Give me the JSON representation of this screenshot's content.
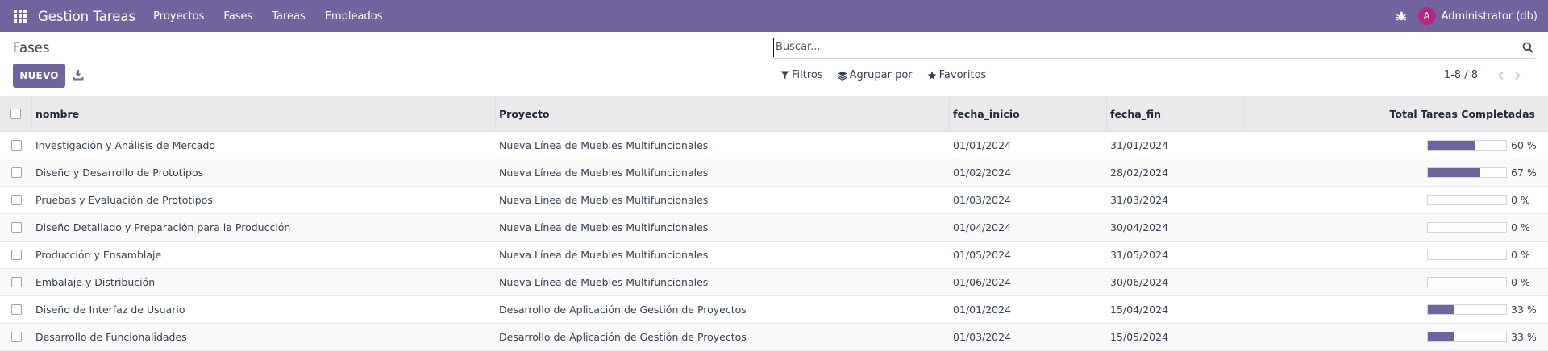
{
  "navbar": {
    "brand": "Gestion Tareas",
    "menu": [
      "Proyectos",
      "Fases",
      "Tareas",
      "Empleados"
    ],
    "avatar_letter": "A",
    "user": "Administrator (db)"
  },
  "control": {
    "title": "Fases",
    "new_label": "NUEVO",
    "search_placeholder": "Buscar...",
    "filters_label": "Filtros",
    "group_label": "Agrupar por",
    "favorites_label": "Favoritos",
    "pager": "1-8 / 8"
  },
  "table": {
    "headers": {
      "nombre": "nombre",
      "proyecto": "Proyecto",
      "inicio": "fecha_inicio",
      "fin": "fecha_fin",
      "total": "Total Tareas Completadas"
    },
    "rows": [
      {
        "nombre": "Investigación y Análisis de Mercado",
        "proyecto": "Nueva Línea de Muebles Multifuncionales",
        "inicio": "01/01/2024",
        "fin": "31/01/2024",
        "pct": 60,
        "pct_label": "60 %"
      },
      {
        "nombre": "Diseño y Desarrollo de Prototipos",
        "proyecto": "Nueva Línea de Muebles Multifuncionales",
        "inicio": "01/02/2024",
        "fin": "28/02/2024",
        "pct": 67,
        "pct_label": "67 %"
      },
      {
        "nombre": "Pruebas y Evaluación de Prototipos",
        "proyecto": "Nueva Línea de Muebles Multifuncionales",
        "inicio": "01/03/2024",
        "fin": "31/03/2024",
        "pct": 0,
        "pct_label": "0 %"
      },
      {
        "nombre": "Diseño Detallado y Preparación para la Producción",
        "proyecto": "Nueva Línea de Muebles Multifuncionales",
        "inicio": "01/04/2024",
        "fin": "30/04/2024",
        "pct": 0,
        "pct_label": "0 %"
      },
      {
        "nombre": "Producción y Ensamblaje",
        "proyecto": "Nueva Línea de Muebles Multifuncionales",
        "inicio": "01/05/2024",
        "fin": "31/05/2024",
        "pct": 0,
        "pct_label": "0 %"
      },
      {
        "nombre": "Embalaje y Distribución",
        "proyecto": "Nueva Línea de Muebles Multifuncionales",
        "inicio": "01/06/2024",
        "fin": "30/06/2024",
        "pct": 0,
        "pct_label": "0 %"
      },
      {
        "nombre": "Diseño de Interfaz de Usuario",
        "proyecto": "Desarrollo de Aplicación de Gestión de Proyectos",
        "inicio": "01/01/2024",
        "fin": "15/04/2024",
        "pct": 33,
        "pct_label": "33 %"
      },
      {
        "nombre": "Desarrollo de Funcionalidades",
        "proyecto": "Desarrollo de Aplicación de Gestión de Proyectos",
        "inicio": "01/03/2024",
        "fin": "15/05/2024",
        "pct": 33,
        "pct_label": "33 %"
      }
    ]
  },
  "colors": {
    "brand": "#71639e",
    "avatar": "#b5267e"
  },
  "icons": [
    "apps-grid-icon",
    "bug-icon",
    "download-icon",
    "search-icon",
    "filter-icon",
    "layers-icon",
    "star-icon",
    "chevron-left-icon",
    "chevron-right-icon"
  ]
}
